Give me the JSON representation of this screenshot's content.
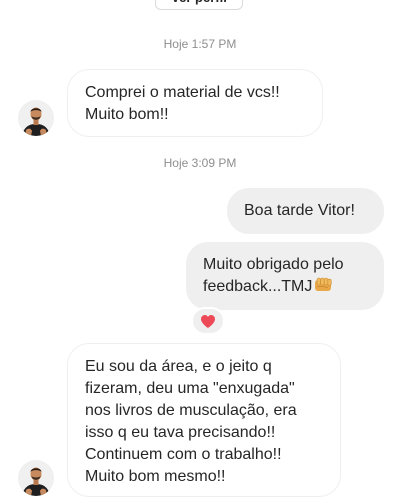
{
  "header": {
    "profile_button_label": "Ver perfil"
  },
  "thread": {
    "timestamps": [
      "Hoje 1:57 PM",
      "Hoje 3:09 PM"
    ],
    "messages": [
      {
        "sender": "other",
        "text": "Comprei o material de vcs!!\nMuito bom!!"
      },
      {
        "sender": "me",
        "text": "Boa tarde Vitor!"
      },
      {
        "sender": "me",
        "text": "Muito obrigado pelo\nfeedback...TMJ",
        "emoji": "fist-bump-icon"
      },
      {
        "sender": "other",
        "text": "Eu sou da área, e o jeito q\nfizeram, deu uma \"enxugada\"\nnos livros de musculação, era\nisso q eu tava precisando!!\nContinuem com o trabalho!!\nMuito bom mesmo!!"
      }
    ],
    "reaction": {
      "icon": "heart-icon",
      "color": "#ed4956"
    }
  },
  "colors": {
    "outgoing_bubble": "#efefef",
    "incoming_border": "#efefef",
    "timestamp": "#8e8e8e",
    "text": "#262626"
  }
}
